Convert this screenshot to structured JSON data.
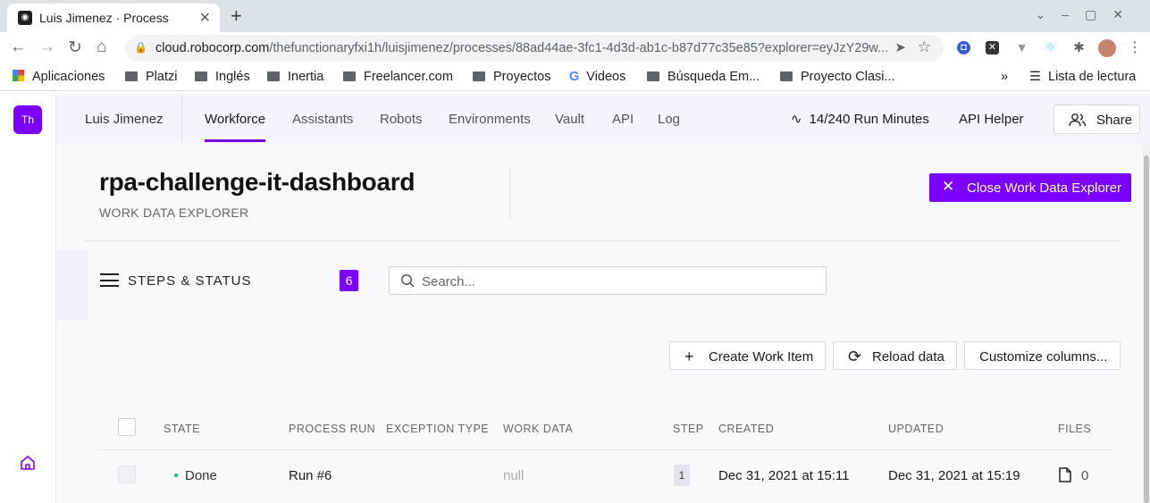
{
  "browser": {
    "tab_title": "Luis Jimenez · Process",
    "url_host": "cloud.robocorp.com",
    "url_rest": "/thefunctionaryfxi1h/luisjimenez/processes/88ad44ae-3fc1-4d3d-ab1c-b87d77c35e85?explorer=eyJzY29w...",
    "bookmarks": [
      "Aplicaciones",
      "Platzi",
      "Inglés",
      "Inertia",
      "Freelancer.com",
      "Proyectos",
      "Videos",
      "Búsqueda Em...",
      "Proyecto Clasi..."
    ],
    "more": "»",
    "reading_list": "Lista de lectura"
  },
  "app": {
    "avatar": "Th",
    "org": "Luis Jimenez",
    "nav": [
      "Workforce",
      "Assistants",
      "Robots",
      "Environments",
      "Vault",
      "API",
      "Log"
    ],
    "active_nav": "Workforce",
    "run_minutes": "14/240 Run Minutes",
    "api_helper": "API Helper",
    "share": "Share"
  },
  "page": {
    "title": "rpa-challenge-it-dashboard",
    "subtitle": "WORK DATA EXPLORER",
    "close_button": "Close Work Data Explorer",
    "steps_label": "STEPS & STATUS",
    "steps_count": "6",
    "search_placeholder": "Search...",
    "buttons": {
      "create": "Create Work Item",
      "reload": "Reload data",
      "customize": "Customize columns..."
    }
  },
  "table": {
    "columns": [
      "STATE",
      "PROCESS RUN",
      "EXCEPTION TYPE",
      "WORK DATA",
      "STEP",
      "CREATED",
      "UPDATED",
      "FILES"
    ],
    "rows": [
      {
        "state": "Done",
        "process_run": "Run #6",
        "exception_type": "",
        "work_data": "null",
        "step": "1",
        "created": "Dec 31, 2021 at 15:11",
        "updated": "Dec 31, 2021 at 15:19",
        "files": "0"
      }
    ]
  },
  "colors": {
    "accent": "#7b00ff",
    "done_dot": "#1ebd6e"
  }
}
